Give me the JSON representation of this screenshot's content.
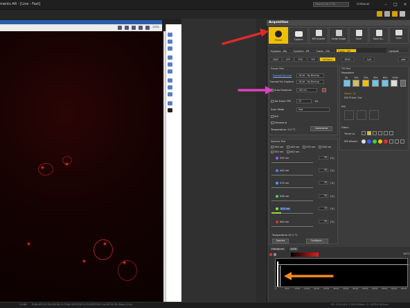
{
  "window": {
    "title": "ments AR - [Live - Fast]",
    "search_placeholder": "Search (Ctrl+F3)",
    "user": "Limbouer"
  },
  "image_panel": {
    "zoom": "100%"
  },
  "status_bar": {
    "left": "1:1.00",
    "mid": "PLAN APO VC 20x DIC N2 (0.75 NA, MITUTOYO 0.75 MITUTOYO 20x DIC N2 Pin Zoom (1.0x)",
    "right": "XY: -2,511.441 -1,793.5 Pulse=, Z: -1075.0 10.5 μm"
  },
  "acquisition": {
    "title": "Acquisition",
    "buttons": [
      {
        "label": "Freeze",
        "icon": "pause-icon"
      },
      {
        "label": "Capture",
        "icon": "camera-icon"
      },
      {
        "label": "ND Acquire",
        "icon": "nd-acquire-icon"
      },
      {
        "label": "Large Image",
        "icon": "large-image-icon"
      },
      {
        "label": "Save",
        "icon": "save-icon"
      },
      {
        "label": "Save As...",
        "icon": "save-as-icon"
      },
      {
        "label": "Open",
        "icon": "folder-icon"
      }
    ],
    "optconf_tabs": [
      "Eyepiece - DIA",
      "Eyepiece - EPI",
      "Fusion - DIA",
      "Fusion - EPI",
      "Lightpath"
    ],
    "channels": [
      "DAPI",
      "CFP",
      "FITC",
      "YFP",
      "mCherry",
      "TRITC",
      "Cy5",
      "Add"
    ],
    "fusion_pad": {
      "title": "Fusion Pad",
      "format_live_label": "Format For Live",
      "format_live_value": "16-bit - No Binning",
      "format_capture_label": "Format For Capture",
      "format_capture_value": "16-bit - No Binning",
      "auto_exposure_label": "Auto Exposure",
      "exposure_value": "100 ms",
      "set_exact_fps_label": "Set Exact FPS",
      "fps_value": "25",
      "fps_unit": "1/s",
      "scan_mode_label": "Scan Mode",
      "scan_mode_value": "Fast",
      "roi_label": "ROI",
      "denoise_label": "Denoise.ai",
      "temperature_label": "Temperature -0.0 °C",
      "commands_label": "Commands"
    },
    "spectra_pad": {
      "title": "Spectra Pad",
      "checks": [
        "395 nm",
        "440 nm",
        "470 nm",
        "508 nm",
        "555 nm",
        "640 nm"
      ],
      "channels": [
        {
          "name": "395 nm",
          "value": "50",
          "color": "#9b5cff"
        },
        {
          "name": "440 nm",
          "value": "49",
          "color": "#5b7cff"
        },
        {
          "name": "470 nm",
          "value": "49",
          "color": "#3fa0ff"
        },
        {
          "name": "508 nm",
          "value": "50",
          "color": "#4cd05a"
        },
        {
          "name": "555 nm",
          "value": "15",
          "color": "#9bdc40"
        },
        {
          "name": "640 nm",
          "value": "50",
          "color": "#e03030"
        }
      ],
      "temperature": "Temperature 25.1 °C",
      "spectra_label": "Spectra",
      "configure_label": "Configure..."
    },
    "ti2_pad": {
      "title": "Ti2 Pad",
      "nosepiece_label": "Nosepiece",
      "objectives": [
        "4x",
        "10x",
        "20x",
        "40x",
        "60x",
        "100x"
      ],
      "zoom_label": "Zoom: 1x",
      "dic_prism_label": "DIC Prism: Out",
      "pfs_label": "PFS",
      "filters_label": "Filters",
      "turret_label": "Turret Lo",
      "wheel_label": "EM Wheel1"
    },
    "histogram": {
      "tab1": "Histogram",
      "tab2": "LUTs",
      "gamma": "G: 1.00",
      "max": "1973",
      "axis_ticks": [
        "0",
        "5000",
        "10000",
        "15000",
        "20000",
        "25000",
        "30000",
        "35000",
        "40000",
        "45000",
        "50000",
        "55000",
        "60000",
        "65000"
      ]
    }
  },
  "colors": {
    "accent": "#f0c000",
    "annotation_red": "#e02a2a",
    "annotation_magenta": "#e040c0",
    "annotation_orange": "#f08a1e"
  }
}
